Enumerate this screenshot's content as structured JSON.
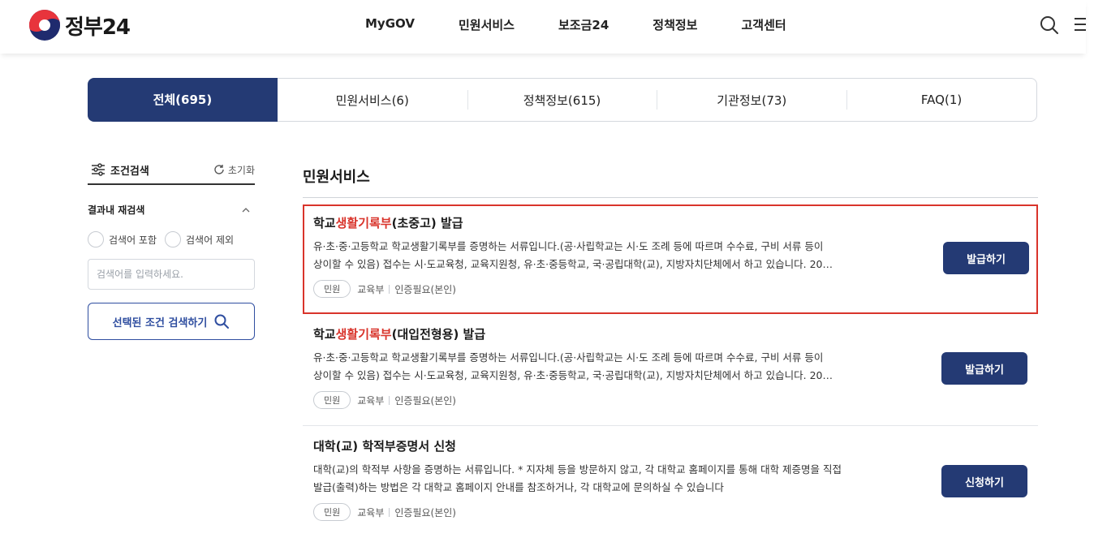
{
  "header": {
    "logo_text": "정부24",
    "nav": [
      "MyGOV",
      "민원서비스",
      "보조금24",
      "정책정보",
      "고객센터"
    ],
    "search_icon": "search-icon",
    "menu_icon": "hamburger-menu-icon"
  },
  "tabs": [
    {
      "label": "전체(695)",
      "active": true
    },
    {
      "label": "민원서비스(6)",
      "active": false
    },
    {
      "label": "정책정보(615)",
      "active": false
    },
    {
      "label": "기관정보(73)",
      "active": false
    },
    {
      "label": "FAQ(1)",
      "active": false
    }
  ],
  "sidebar": {
    "title": "조건검색",
    "reset_label": "초기화",
    "research_title": "결과내 재검색",
    "include_label": "검색어 포함",
    "exclude_label": "검색어 제외",
    "input_placeholder": "검색어를 입력하세요.",
    "search_button": "선택된 조건 검색하기"
  },
  "main": {
    "section_title": "민원서비스",
    "items": [
      {
        "title_pre": "학교",
        "title_hl": "생활기록부",
        "title_post": "(초중고) 발급",
        "desc1": "유·초·중·고등학교 학교생활기록부를 증명하는 서류입니다.(공·사립학교는 시·도 조례 등에 따르며 수수료, 구비 서류 등이",
        "desc2": "상이할 수 있음) 접수는 시·도교육청, 교육지원청, 유·초·중등학교, 국·공립대학(교), 지방자치단체에서 하고 있습니다. 20…",
        "badge": "민원",
        "org": "교육부",
        "auth": "인증필요(본인)",
        "button": "발급하기"
      },
      {
        "title_pre": "학교",
        "title_hl": "생활기록부",
        "title_post": "(대입전형용) 발급",
        "desc1": "유·초·중·고등학교 학교생활기록부를 증명하는 서류입니다.(공·사립학교는 시·도 조례 등에 따르며 수수료, 구비 서류 등이",
        "desc2": "상이할 수 있음) 접수는 시·도교육청, 교육지원청, 유·초·중등학교, 국·공립대학(교), 지방자치단체에서 하고 있습니다. 20…",
        "badge": "민원",
        "org": "교육부",
        "auth": "인증필요(본인)",
        "button": "발급하기"
      },
      {
        "title_pre": "대학(교) 학적부증명서 신청",
        "title_hl": "",
        "title_post": "",
        "desc1": "대학(교)의 학적부 사항을 증명하는 서류입니다. * 지자체 등을 방문하지 않고, 각 대학교 홈페이지를 통해 대학 제증명을 직접",
        "desc2": "발급(출력)하는 방법은 각 대학교 홈페이지 안내를 참조하거나, 각 대학교에 문의하실 수 있습니다",
        "badge": "민원",
        "org": "교육부",
        "auth": "인증필요(본인)",
        "button": "신청하기"
      }
    ]
  },
  "colors": {
    "primary": "#243a74",
    "highlight": "#d9342b",
    "border": "#d4d8de"
  }
}
